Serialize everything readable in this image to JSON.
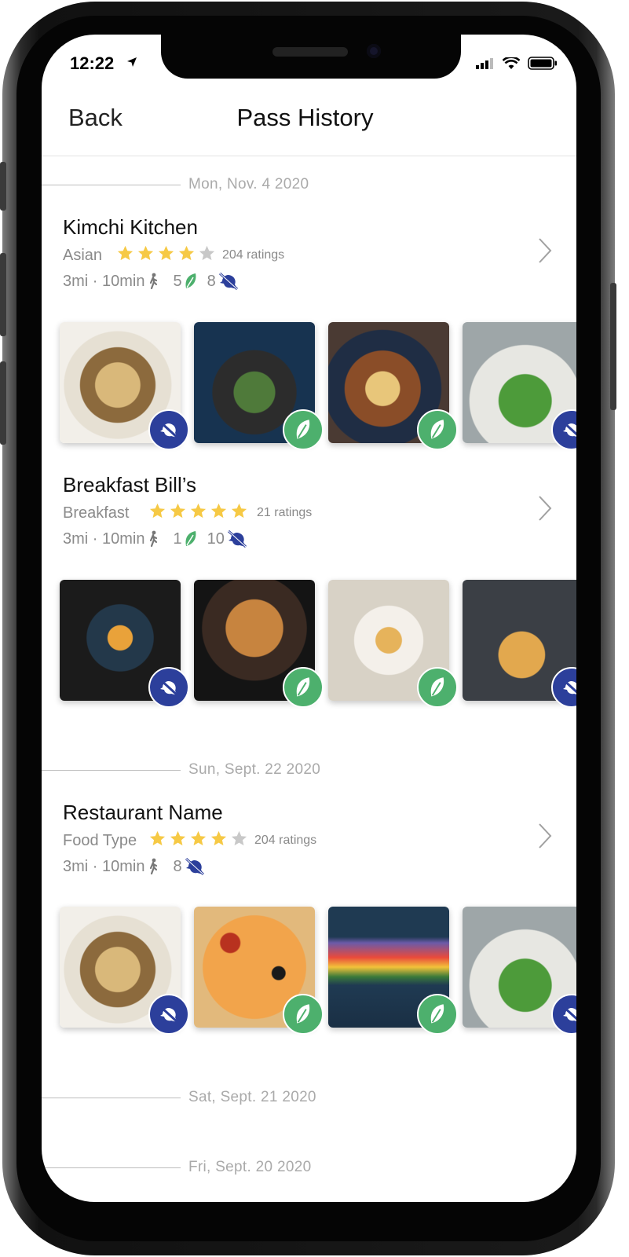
{
  "status_bar": {
    "time": "12:22"
  },
  "header": {
    "back_label": "Back",
    "title": "Pass History"
  },
  "colors": {
    "accent_green": "#4db06d",
    "accent_blue": "#2c3f9b",
    "star_gold": "#f6c945",
    "star_grey": "#c8c8c8"
  },
  "sections": [
    {
      "date": "Mon, Nov. 4 2020",
      "restaurants": [
        {
          "name": "Kimchi Kitchen",
          "type": "Asian",
          "rating": 4,
          "ratings_text": "204 ratings",
          "distance": "3mi · 10min",
          "leaf_count": "5",
          "nosave_count": "8",
          "photo_badges": [
            "blue",
            "green",
            "green",
            "blue"
          ]
        },
        {
          "name": "Breakfast Bill’s",
          "type": "Breakfast",
          "rating": 5,
          "ratings_text": "21 ratings",
          "distance": "3mi · 10min",
          "leaf_count": "1",
          "nosave_count": "10",
          "photo_badges": [
            "blue",
            "green",
            "green",
            "blue"
          ]
        }
      ]
    },
    {
      "date": "Sun, Sept. 22 2020",
      "restaurants": [
        {
          "name": "Restaurant Name",
          "type": "Food Type",
          "rating": 4,
          "ratings_text": "204 ratings",
          "distance": "3mi · 10min",
          "nosave_count": "8",
          "photo_badges": [
            "blue",
            "green",
            "green",
            "blue"
          ]
        }
      ]
    },
    {
      "date": "Sat, Sept. 21 2020"
    },
    {
      "date": "Fri, Sept. 20 2020"
    }
  ]
}
